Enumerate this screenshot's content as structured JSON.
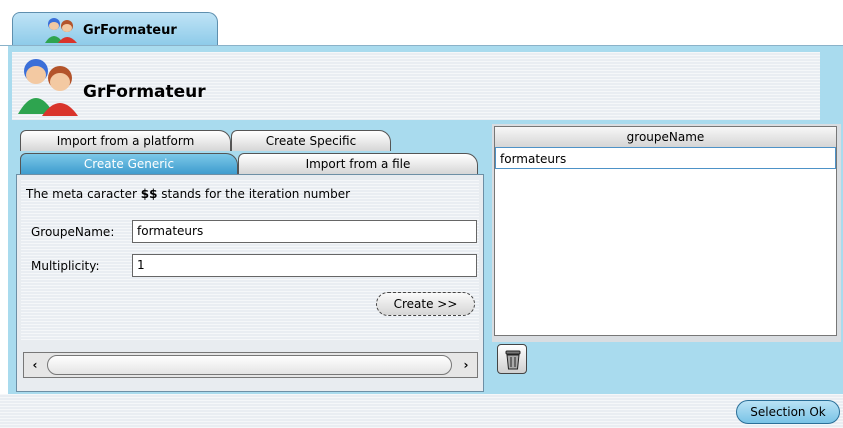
{
  "window_tab": {
    "label": "GrFormateur",
    "icon": "users-icon"
  },
  "header": {
    "title": "GrFormateur",
    "icon": "users-icon"
  },
  "left_panel": {
    "tabs_row1": [
      {
        "label": "Import from a platform"
      },
      {
        "label": "Create Specific"
      }
    ],
    "tabs_row2": [
      {
        "label": "Create Generic",
        "active": true
      },
      {
        "label": "Import from a file"
      }
    ],
    "meta_text_prefix": "The meta caracter ",
    "meta_token": "$$",
    "meta_text_suffix": " stands for the iteration number",
    "fields": {
      "groupe_name_label": "GroupeName:",
      "groupe_name_value": "formateurs",
      "multiplicity_label": "Multiplicity:",
      "multiplicity_value": "1"
    },
    "create_button": "Create >>"
  },
  "table": {
    "column": "groupeName",
    "rows": [
      "formateurs"
    ]
  },
  "trash_button": {
    "icon": "trash-icon"
  },
  "bottom": {
    "selection_ok": "Selection Ok"
  },
  "colors": {
    "accent": "#8ecbe9",
    "panel": "#a9dbee",
    "active_tab": "#3e9cce"
  }
}
